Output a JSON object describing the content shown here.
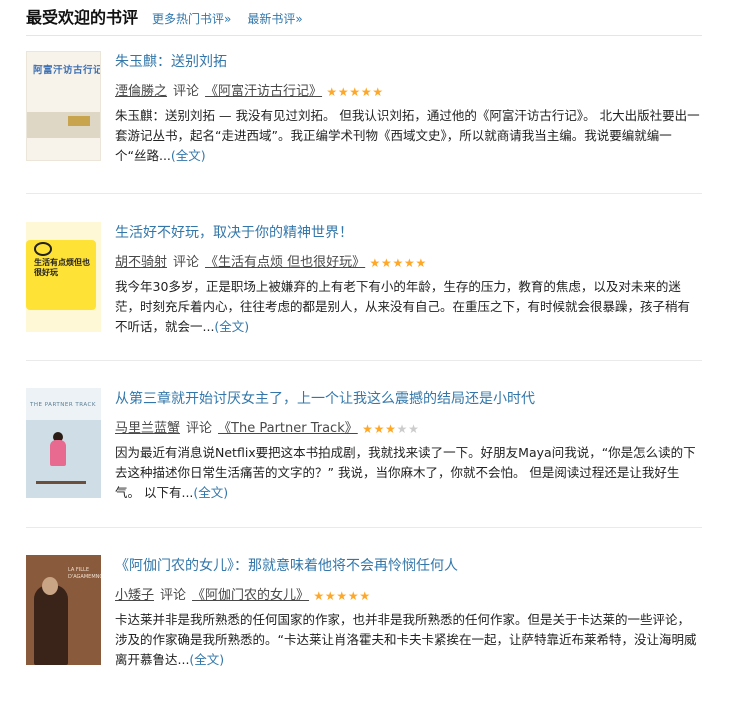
{
  "header": {
    "title": "最受欢迎的书评",
    "links": [
      "更多热门书评»",
      "最新书评»"
    ]
  },
  "reviews": [
    {
      "title": "朱玉麒：送别刘拓",
      "author": "湮倫勝之",
      "action": "评论",
      "book": "《阿富汗访古行记》",
      "rating": 5,
      "excerpt": "朱玉麒：送别刘拓 — 我没有见过刘拓。 但我认识刘拓，通过他的《阿富汗访古行记》。 北大出版社要出一套游记丛书，起名“走进西域”。我正编学术刊物《西域文史》，所以就商请我当主编。我说要编就编一个“丝路...",
      "full": "(全文)",
      "cover_text": "阿富汗访古行记",
      "cover_icon": "book-cover-afghanistan"
    },
    {
      "title": "生活好不好玩，取决于你的精神世界！",
      "author": "胡不骑射",
      "action": "评论",
      "book": "《生活有点烦 但也很好玩》",
      "rating": 5,
      "excerpt": "我今年30多岁，正是职场上被嫌弃的上有老下有小的年龄，生存的压力，教育的焦虑，以及对未来的迷茫，时刻充斥着内心，往往考虑的都是别人，从来没有自己。在重压之下，有时候就会很暴躁，孩子稍有不听话，就会一...",
      "full": "(全文)",
      "cover_text": "生活有点烦但也很好玩",
      "cover_icon": "book-cover-life"
    },
    {
      "title": "从第三章就开始讨厌女主了，上一个让我这么震撼的结局还是小时代",
      "author": "马里兰蓝蟹",
      "action": "评论",
      "book": "《The Partner Track》",
      "rating": 3,
      "excerpt": "因为最近有消息说Netflix要把这本书拍成剧，我就找来读了一下。好朋友Maya问我说，“你是怎么读的下去这种描述你日常生活痛苦的文字的？” 我说，当你麻木了，你就不会怕。 但是阅读过程还是让我好生气。 以下有...",
      "full": "(全文)",
      "cover_text": "THE PARTNER TRACK",
      "cover_icon": "book-cover-partner-track"
    },
    {
      "title": "《阿伽门农的女儿》：那就意味着他将不会再怜悯任何人",
      "author": "小矮子",
      "action": "评论",
      "book": "《阿伽门农的女儿》",
      "rating": 5,
      "excerpt": "卡达莱并非是我所熟悉的任何国家的作家，也并非是我所熟悉的任何作家。但是关于卡达莱的一些评论，涉及的作家确是我所熟悉的。“卡达莱让肖洛霍夫和卡夫卡紧挨在一起，让萨特靠近布莱希特，没让海明威离开慕鲁达...",
      "full": "(全文)",
      "cover_text": "LA FILLE D'AGAMEMNON",
      "cover_icon": "book-cover-agamemnon"
    }
  ],
  "colors": {
    "link": "#3377aa",
    "star": "#ffa726",
    "star_off": "#cccccc",
    "divider": "#eaeaea"
  }
}
